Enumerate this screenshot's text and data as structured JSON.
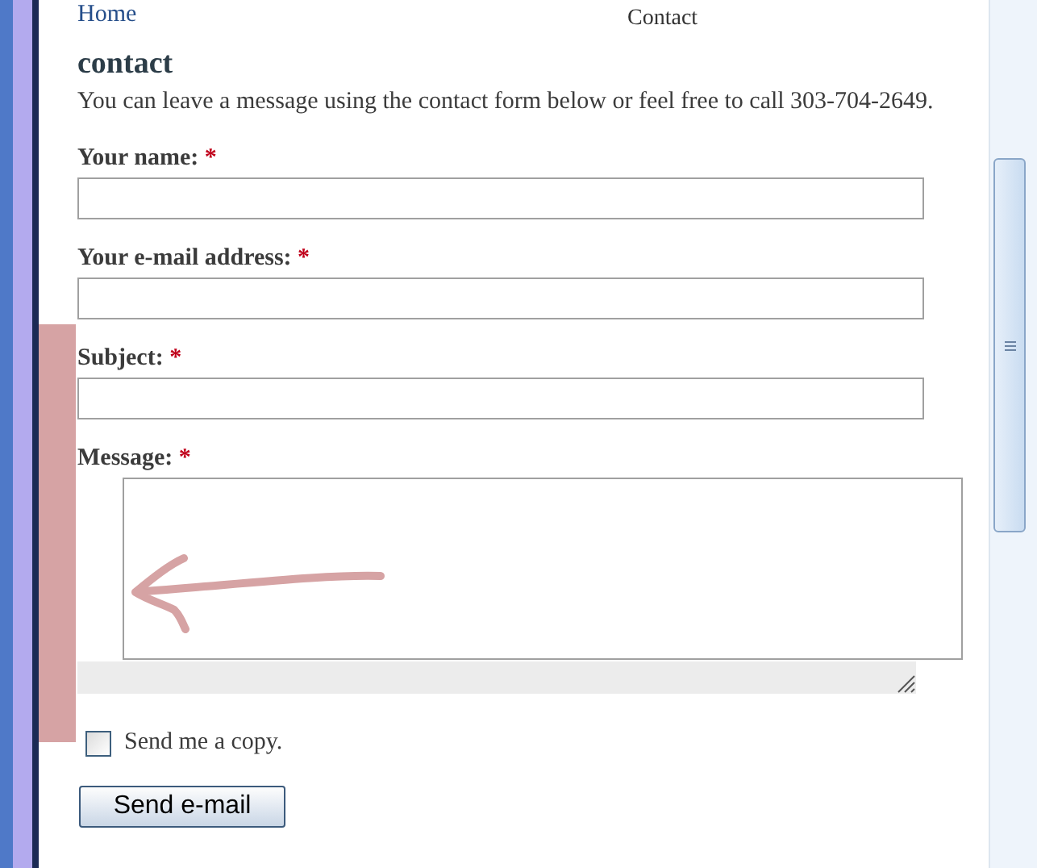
{
  "breadcrumb": {
    "home_link": "Home",
    "current": "Contact"
  },
  "heading": "contact",
  "intro": "You can leave a message using the contact form below or feel free to call 303-704-2649.",
  "fields": [
    {
      "label": "Your name:",
      "required_mark": "*",
      "kind": "input"
    },
    {
      "label": "Your e-mail address:",
      "required_mark": "*",
      "kind": "input"
    },
    {
      "label": "Subject:",
      "required_mark": "*",
      "kind": "input"
    },
    {
      "label": "Message:",
      "required_mark": "*",
      "kind": "textarea"
    }
  ],
  "copy_checkbox": {
    "label": "Send me a copy.",
    "checked": false
  },
  "submit_button": "Send e-mail"
}
